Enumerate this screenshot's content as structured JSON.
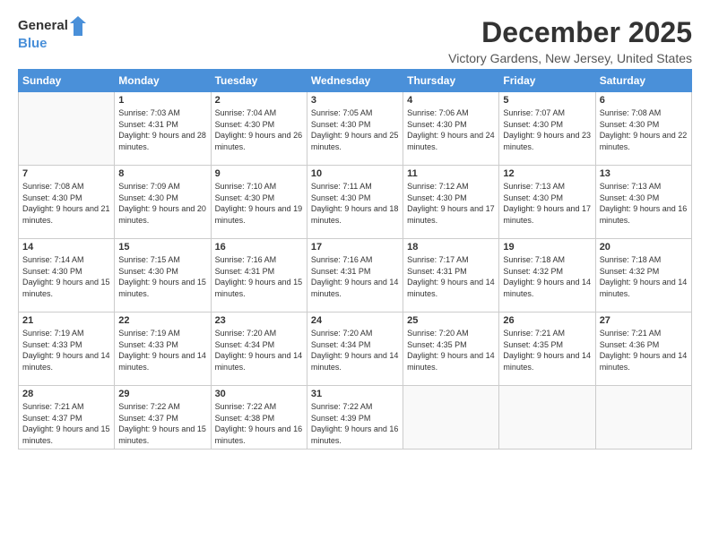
{
  "logo": {
    "general": "General",
    "blue": "Blue"
  },
  "title": "December 2025",
  "subtitle": "Victory Gardens, New Jersey, United States",
  "days_of_week": [
    "Sunday",
    "Monday",
    "Tuesday",
    "Wednesday",
    "Thursday",
    "Friday",
    "Saturday"
  ],
  "weeks": [
    [
      {
        "day": "",
        "sunrise": "",
        "sunset": "",
        "daylight": ""
      },
      {
        "day": "1",
        "sunrise": "Sunrise: 7:03 AM",
        "sunset": "Sunset: 4:31 PM",
        "daylight": "Daylight: 9 hours and 28 minutes."
      },
      {
        "day": "2",
        "sunrise": "Sunrise: 7:04 AM",
        "sunset": "Sunset: 4:30 PM",
        "daylight": "Daylight: 9 hours and 26 minutes."
      },
      {
        "day": "3",
        "sunrise": "Sunrise: 7:05 AM",
        "sunset": "Sunset: 4:30 PM",
        "daylight": "Daylight: 9 hours and 25 minutes."
      },
      {
        "day": "4",
        "sunrise": "Sunrise: 7:06 AM",
        "sunset": "Sunset: 4:30 PM",
        "daylight": "Daylight: 9 hours and 24 minutes."
      },
      {
        "day": "5",
        "sunrise": "Sunrise: 7:07 AM",
        "sunset": "Sunset: 4:30 PM",
        "daylight": "Daylight: 9 hours and 23 minutes."
      },
      {
        "day": "6",
        "sunrise": "Sunrise: 7:08 AM",
        "sunset": "Sunset: 4:30 PM",
        "daylight": "Daylight: 9 hours and 22 minutes."
      }
    ],
    [
      {
        "day": "7",
        "sunrise": "Sunrise: 7:08 AM",
        "sunset": "Sunset: 4:30 PM",
        "daylight": "Daylight: 9 hours and 21 minutes."
      },
      {
        "day": "8",
        "sunrise": "Sunrise: 7:09 AM",
        "sunset": "Sunset: 4:30 PM",
        "daylight": "Daylight: 9 hours and 20 minutes."
      },
      {
        "day": "9",
        "sunrise": "Sunrise: 7:10 AM",
        "sunset": "Sunset: 4:30 PM",
        "daylight": "Daylight: 9 hours and 19 minutes."
      },
      {
        "day": "10",
        "sunrise": "Sunrise: 7:11 AM",
        "sunset": "Sunset: 4:30 PM",
        "daylight": "Daylight: 9 hours and 18 minutes."
      },
      {
        "day": "11",
        "sunrise": "Sunrise: 7:12 AM",
        "sunset": "Sunset: 4:30 PM",
        "daylight": "Daylight: 9 hours and 17 minutes."
      },
      {
        "day": "12",
        "sunrise": "Sunrise: 7:13 AM",
        "sunset": "Sunset: 4:30 PM",
        "daylight": "Daylight: 9 hours and 17 minutes."
      },
      {
        "day": "13",
        "sunrise": "Sunrise: 7:13 AM",
        "sunset": "Sunset: 4:30 PM",
        "daylight": "Daylight: 9 hours and 16 minutes."
      }
    ],
    [
      {
        "day": "14",
        "sunrise": "Sunrise: 7:14 AM",
        "sunset": "Sunset: 4:30 PM",
        "daylight": "Daylight: 9 hours and 15 minutes."
      },
      {
        "day": "15",
        "sunrise": "Sunrise: 7:15 AM",
        "sunset": "Sunset: 4:30 PM",
        "daylight": "Daylight: 9 hours and 15 minutes."
      },
      {
        "day": "16",
        "sunrise": "Sunrise: 7:16 AM",
        "sunset": "Sunset: 4:31 PM",
        "daylight": "Daylight: 9 hours and 15 minutes."
      },
      {
        "day": "17",
        "sunrise": "Sunrise: 7:16 AM",
        "sunset": "Sunset: 4:31 PM",
        "daylight": "Daylight: 9 hours and 14 minutes."
      },
      {
        "day": "18",
        "sunrise": "Sunrise: 7:17 AM",
        "sunset": "Sunset: 4:31 PM",
        "daylight": "Daylight: 9 hours and 14 minutes."
      },
      {
        "day": "19",
        "sunrise": "Sunrise: 7:18 AM",
        "sunset": "Sunset: 4:32 PM",
        "daylight": "Daylight: 9 hours and 14 minutes."
      },
      {
        "day": "20",
        "sunrise": "Sunrise: 7:18 AM",
        "sunset": "Sunset: 4:32 PM",
        "daylight": "Daylight: 9 hours and 14 minutes."
      }
    ],
    [
      {
        "day": "21",
        "sunrise": "Sunrise: 7:19 AM",
        "sunset": "Sunset: 4:33 PM",
        "daylight": "Daylight: 9 hours and 14 minutes."
      },
      {
        "day": "22",
        "sunrise": "Sunrise: 7:19 AM",
        "sunset": "Sunset: 4:33 PM",
        "daylight": "Daylight: 9 hours and 14 minutes."
      },
      {
        "day": "23",
        "sunrise": "Sunrise: 7:20 AM",
        "sunset": "Sunset: 4:34 PM",
        "daylight": "Daylight: 9 hours and 14 minutes."
      },
      {
        "day": "24",
        "sunrise": "Sunrise: 7:20 AM",
        "sunset": "Sunset: 4:34 PM",
        "daylight": "Daylight: 9 hours and 14 minutes."
      },
      {
        "day": "25",
        "sunrise": "Sunrise: 7:20 AM",
        "sunset": "Sunset: 4:35 PM",
        "daylight": "Daylight: 9 hours and 14 minutes."
      },
      {
        "day": "26",
        "sunrise": "Sunrise: 7:21 AM",
        "sunset": "Sunset: 4:35 PM",
        "daylight": "Daylight: 9 hours and 14 minutes."
      },
      {
        "day": "27",
        "sunrise": "Sunrise: 7:21 AM",
        "sunset": "Sunset: 4:36 PM",
        "daylight": "Daylight: 9 hours and 14 minutes."
      }
    ],
    [
      {
        "day": "28",
        "sunrise": "Sunrise: 7:21 AM",
        "sunset": "Sunset: 4:37 PM",
        "daylight": "Daylight: 9 hours and 15 minutes."
      },
      {
        "day": "29",
        "sunrise": "Sunrise: 7:22 AM",
        "sunset": "Sunset: 4:37 PM",
        "daylight": "Daylight: 9 hours and 15 minutes."
      },
      {
        "day": "30",
        "sunrise": "Sunrise: 7:22 AM",
        "sunset": "Sunset: 4:38 PM",
        "daylight": "Daylight: 9 hours and 16 minutes."
      },
      {
        "day": "31",
        "sunrise": "Sunrise: 7:22 AM",
        "sunset": "Sunset: 4:39 PM",
        "daylight": "Daylight: 9 hours and 16 minutes."
      },
      {
        "day": "",
        "sunrise": "",
        "sunset": "",
        "daylight": ""
      },
      {
        "day": "",
        "sunrise": "",
        "sunset": "",
        "daylight": ""
      },
      {
        "day": "",
        "sunrise": "",
        "sunset": "",
        "daylight": ""
      }
    ]
  ]
}
